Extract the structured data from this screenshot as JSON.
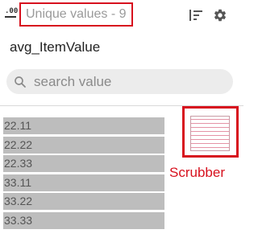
{
  "header": {
    "type_icon_text": ".00",
    "unique_values_label": "Unique values - 9",
    "sort_icon": "sort-icon",
    "settings_icon": "gear-icon"
  },
  "field": {
    "name": "avg_ItemValue"
  },
  "search": {
    "placeholder": "search value",
    "icon": "search-icon"
  },
  "values": [
    "22.11",
    "22.22",
    "22.33",
    "33.11",
    "33.22",
    "33.33"
  ],
  "scrubber": {
    "label": "Scrubber"
  },
  "colors": {
    "annotation_red": "#d7111e",
    "row_background": "#bdbdbd",
    "scrubber_line": "#e593a6"
  }
}
